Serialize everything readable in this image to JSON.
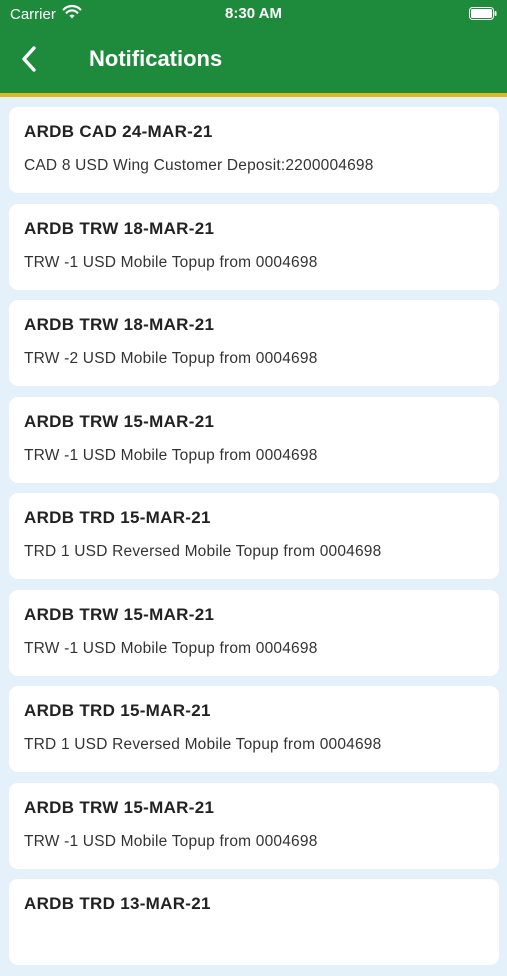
{
  "status_bar": {
    "carrier": "Carrier",
    "time": "8:30 AM"
  },
  "nav": {
    "title": "Notifications",
    "back_icon": "chevron-left-icon"
  },
  "colors": {
    "header": "#1e8a3c",
    "stripe": "#e0b81c",
    "background": "#e4f0fa"
  },
  "notifications": [
    {
      "title": "ARDB CAD 24-MAR-21",
      "body": "CAD 8 USD Wing Customer Deposit:2200004698"
    },
    {
      "title": "ARDB TRW 18-MAR-21",
      "body": "TRW -1 USD Mobile Topup from 0004698"
    },
    {
      "title": "ARDB TRW 18-MAR-21",
      "body": "TRW -2 USD Mobile Topup from 0004698"
    },
    {
      "title": "ARDB TRW 15-MAR-21",
      "body": "TRW -1 USD Mobile Topup from 0004698"
    },
    {
      "title": "ARDB TRD 15-MAR-21",
      "body": "TRD 1 USD Reversed Mobile Topup from 0004698"
    },
    {
      "title": "ARDB TRW 15-MAR-21",
      "body": "TRW -1 USD Mobile Topup from 0004698"
    },
    {
      "title": "ARDB TRD 15-MAR-21",
      "body": "TRD 1 USD Reversed Mobile Topup from 0004698"
    },
    {
      "title": "ARDB TRW 15-MAR-21",
      "body": "TRW -1 USD Mobile Topup from 0004698"
    },
    {
      "title": "ARDB TRD 13-MAR-21",
      "body": ""
    }
  ]
}
